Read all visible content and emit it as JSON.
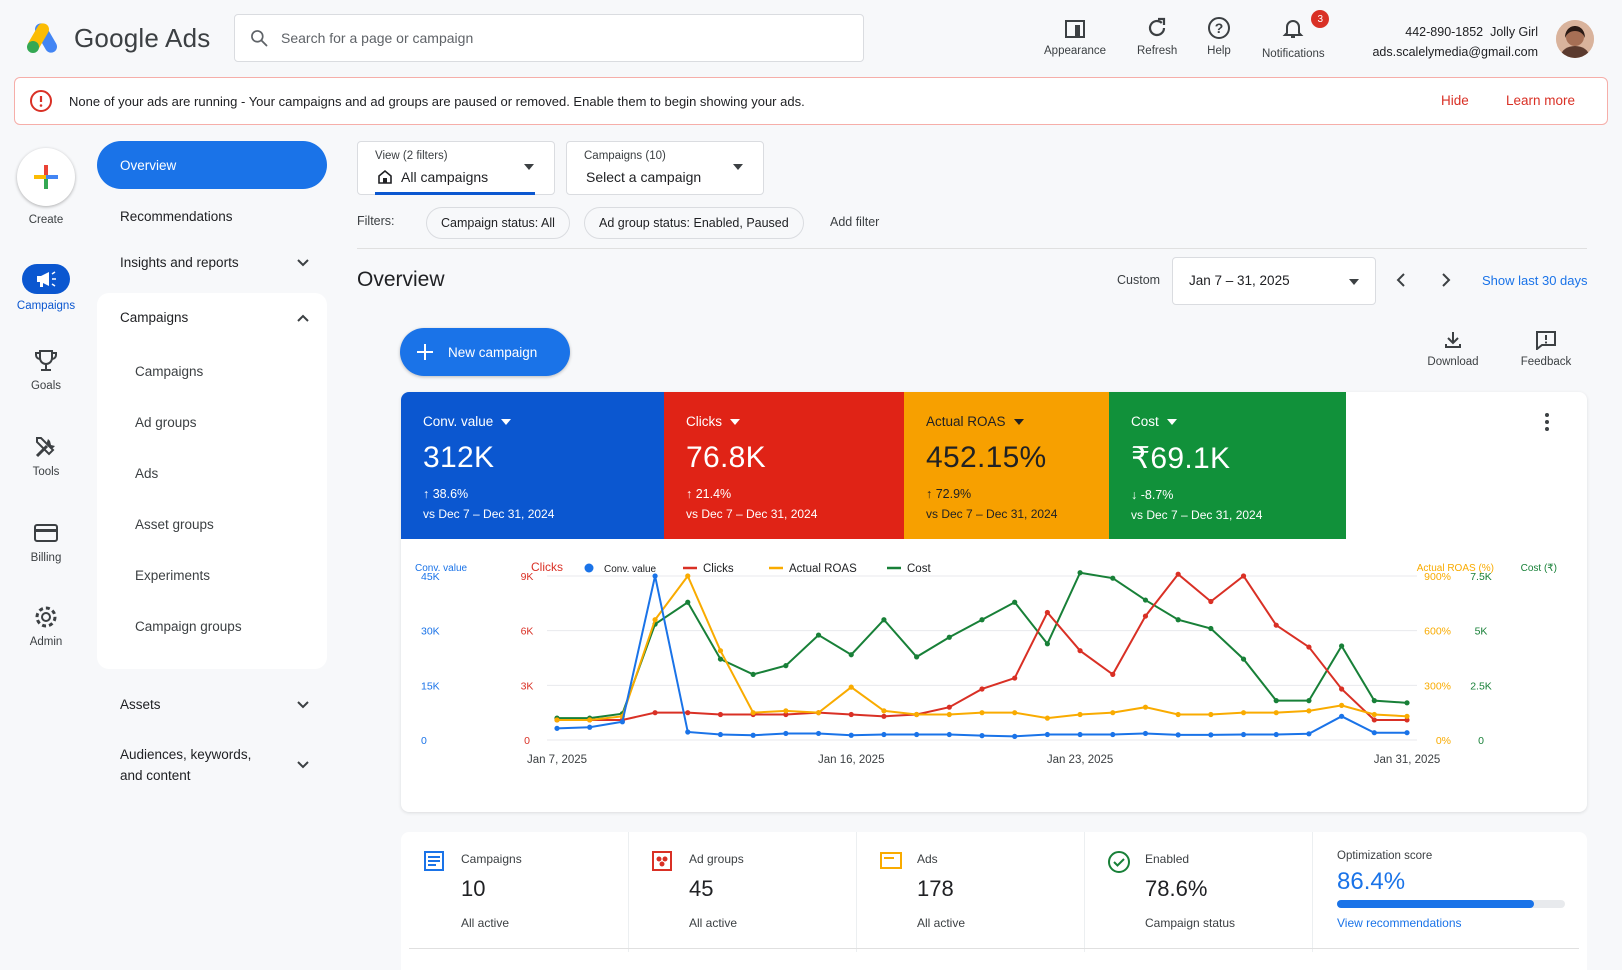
{
  "app": {
    "name": "Google Ads"
  },
  "search": {
    "placeholder": "Search for a page or campaign"
  },
  "top_actions": {
    "appearance": "Appearance",
    "refresh": "Refresh",
    "help": "Help",
    "notifications": "Notifications",
    "notification_count": "3"
  },
  "account": {
    "phone": "442-890-1852",
    "name": "Jolly Girl",
    "email": "ads.scalelymedia@gmail.com"
  },
  "alert": {
    "title": "None of your ads are running",
    "message": " - Your campaigns and ad groups are paused or removed. Enable them to begin showing your ads.",
    "hide": "Hide",
    "learn_more": "Learn more"
  },
  "rail": {
    "create": "Create",
    "campaigns": "Campaigns",
    "goals": "Goals",
    "tools": "Tools",
    "billing": "Billing",
    "admin": "Admin"
  },
  "nav": {
    "overview": "Overview",
    "recommendations": "Recommendations",
    "insights": "Insights and reports",
    "campaigns_header": "Campaigns",
    "campaigns_sub": [
      "Campaigns",
      "Ad groups",
      "Ads",
      "Asset groups",
      "Experiments",
      "Campaign groups"
    ],
    "assets": "Assets",
    "audiences_line1": "Audiences, keywords,",
    "audiences_line2": "and content"
  },
  "view_filter": {
    "label": "View (2 filters)",
    "value": "All campaigns"
  },
  "campaign_filter": {
    "label": "Campaigns (10)",
    "value": "Select a campaign"
  },
  "filters": {
    "label": "Filters:",
    "chips": [
      "Campaign status: All",
      "Ad group status: Enabled, Paused"
    ],
    "add": "Add filter"
  },
  "overview": {
    "title": "Overview",
    "range_label": "Custom",
    "date_range": "Jan 7 – 31, 2025",
    "show_last": "Show last 30 days",
    "new_campaign": "New campaign",
    "download": "Download",
    "feedback": "Feedback"
  },
  "kpis": [
    {
      "label": "Conv. value",
      "value": "312K",
      "change": "↑ 38.6%",
      "compare": "vs Dec 7 – Dec 31, 2024",
      "color": "#0b57d0"
    },
    {
      "label": "Clicks",
      "value": "76.8K",
      "change": "↑ 21.4%",
      "compare": "vs Dec 7 – Dec 31, 2024",
      "color": "#e02316"
    },
    {
      "label": "Actual ROAS",
      "value": "452.15%",
      "change": "↑ 72.9%",
      "compare": "vs Dec 7 – Dec 31, 2024",
      "color": "#f7a000"
    },
    {
      "label": "Cost",
      "value": "₹69.1K",
      "change": "↓ -8.7%",
      "compare": "vs Dec 7 – Dec 31, 2024",
      "color": "#11913a"
    }
  ],
  "chart_data": {
    "type": "line",
    "axis_titles": {
      "left_outer": "Conv. value",
      "left_inner": "Clicks",
      "right_inner": "Actual ROAS (%)",
      "right_outer": "Cost (₹)"
    },
    "legend": [
      "Conv. value",
      "Clicks",
      "Actual ROAS",
      "Cost"
    ],
    "x_ticks": [
      "Jan 7, 2025",
      "Jan 16, 2025",
      "Jan 23, 2025",
      "Jan 31, 2025"
    ],
    "ticks": {
      "conv_value": [
        "0",
        "15K",
        "30K",
        "45K"
      ],
      "clicks": [
        "0",
        "3K",
        "6K",
        "9K"
      ],
      "roas": [
        "0%",
        "300%",
        "600%",
        "900%"
      ],
      "cost": [
        "0",
        "2.5K",
        "5K",
        "7.5K"
      ]
    },
    "series": [
      {
        "name": "Conv. value",
        "color": "#1a73e8",
        "axis_max": 45000,
        "values": [
          3200,
          3500,
          5000,
          45000,
          2200,
          1500,
          1300,
          1800,
          1800,
          1300,
          1500,
          1500,
          1500,
          1200,
          1000,
          1500,
          1500,
          1500,
          1800,
          1400,
          1400,
          1500,
          1500,
          1700,
          6500,
          2000,
          2000
        ]
      },
      {
        "name": "Clicks",
        "color": "#d93025",
        "axis_max": 9000,
        "values": [
          1100,
          1100,
          1100,
          1500,
          1500,
          1400,
          1400,
          1400,
          1500,
          1400,
          1300,
          1400,
          1800,
          2800,
          3400,
          7000,
          4900,
          3600,
          6800,
          9100,
          7600,
          9000,
          6300,
          5100,
          2800,
          1100,
          1100
        ]
      },
      {
        "name": "Actual ROAS",
        "color": "#f9ab00",
        "axis_max": 900,
        "values": [
          110,
          110,
          130,
          660,
          900,
          490,
          150,
          160,
          150,
          290,
          160,
          140,
          140,
          150,
          150,
          120,
          140,
          150,
          180,
          140,
          140,
          150,
          150,
          160,
          190,
          140,
          130
        ]
      },
      {
        "name": "Cost",
        "color": "#188038",
        "axis_max": 7500,
        "values": [
          1000,
          1000,
          1200,
          5300,
          6300,
          3700,
          3000,
          3400,
          4800,
          3900,
          5500,
          3800,
          4700,
          5500,
          6300,
          4400,
          7700,
          7400,
          6400,
          5500,
          5100,
          3700,
          1800,
          1800,
          4300,
          1800,
          1700
        ]
      }
    ],
    "grid": true,
    "legend_position": "top"
  },
  "stats": [
    {
      "label": "Campaigns",
      "value": "10",
      "sub": "All active"
    },
    {
      "label": "Ad groups",
      "value": "45",
      "sub": "All active"
    },
    {
      "label": "Ads",
      "value": "178",
      "sub": "All active"
    },
    {
      "label": "Enabled",
      "value": "78.6%",
      "sub": "Campaign status"
    }
  ],
  "optimization": {
    "label": "Optimization score",
    "value": "86.4%",
    "score": 0.864,
    "link": "View recommendations"
  }
}
